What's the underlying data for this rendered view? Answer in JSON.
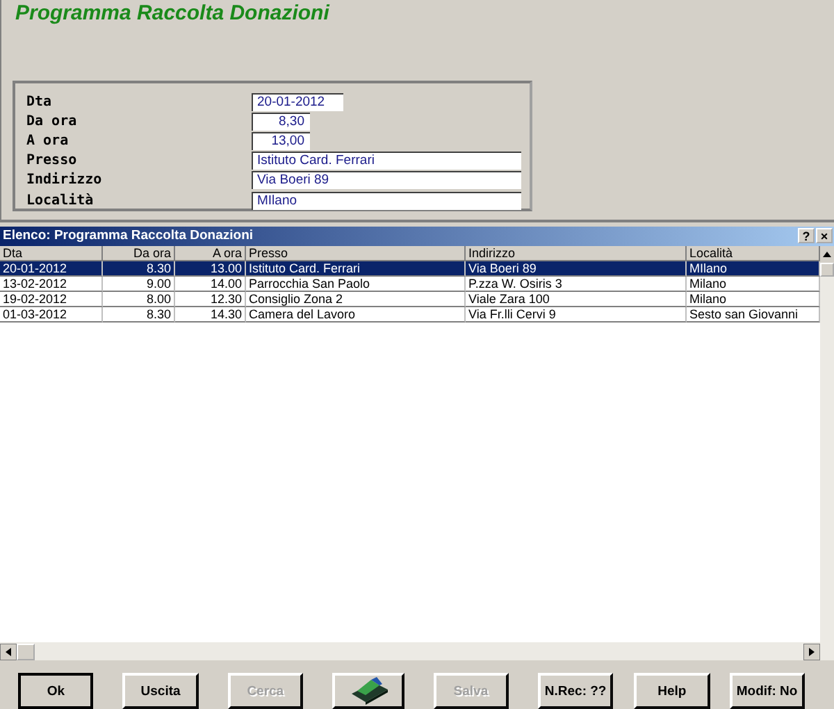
{
  "window": {
    "title": "Programma Raccolta Donazioni"
  },
  "form": {
    "fields": [
      {
        "label": "Dta",
        "value": "20-01-2012"
      },
      {
        "label": "Da ora",
        "value": "8,30"
      },
      {
        "label": "A ora",
        "value": "13,00"
      },
      {
        "label": "Presso",
        "value": "Istituto Card. Ferrari"
      },
      {
        "label": "Indirizzo",
        "value": "Via Boeri 89"
      },
      {
        "label": "Località",
        "value": "MIlano"
      }
    ]
  },
  "list": {
    "title": "Elenco: Programma Raccolta Donazioni",
    "help_button": "?",
    "close_button": "×",
    "columns": [
      "Dta",
      "Da ora",
      "A ora",
      "Presso",
      "Indirizzo",
      "Località"
    ],
    "rows": [
      {
        "cells": [
          "20-01-2012",
          "8.30",
          "13.00",
          "Istituto Card. Ferrari",
          "Via Boeri 89",
          "MIlano"
        ],
        "selected": true
      },
      {
        "cells": [
          "13-02-2012",
          "9.00",
          "14.00",
          "Parrocchia San Paolo",
          "P.zza W. Osiris 3",
          "Milano"
        ],
        "selected": false
      },
      {
        "cells": [
          "19-02-2012",
          "8.00",
          "12.30",
          "Consiglio Zona 2",
          "Viale Zara 100",
          "Milano"
        ],
        "selected": false
      },
      {
        "cells": [
          "01-03-2012",
          "8.30",
          "14.30",
          "Camera del Lavoro",
          "Via Fr.lli Cervi 9",
          "Sesto san Giovanni"
        ],
        "selected": false
      }
    ]
  },
  "buttons": [
    {
      "kind": "text",
      "label": "Ok",
      "disabled": false,
      "default": true
    },
    {
      "kind": "text",
      "label": "Uscita",
      "disabled": false,
      "default": false
    },
    {
      "kind": "text",
      "label": "Cerca",
      "disabled": true,
      "default": false
    },
    {
      "kind": "icon"
    },
    {
      "kind": "text",
      "label": "Salva",
      "disabled": true,
      "default": false
    },
    {
      "kind": "text",
      "label": "N.Rec: ??",
      "disabled": false,
      "default": false
    },
    {
      "kind": "text",
      "label": "Help",
      "disabled": false,
      "default": false
    },
    {
      "kind": "text",
      "label": "Modif: No",
      "disabled": false,
      "default": false
    }
  ]
}
